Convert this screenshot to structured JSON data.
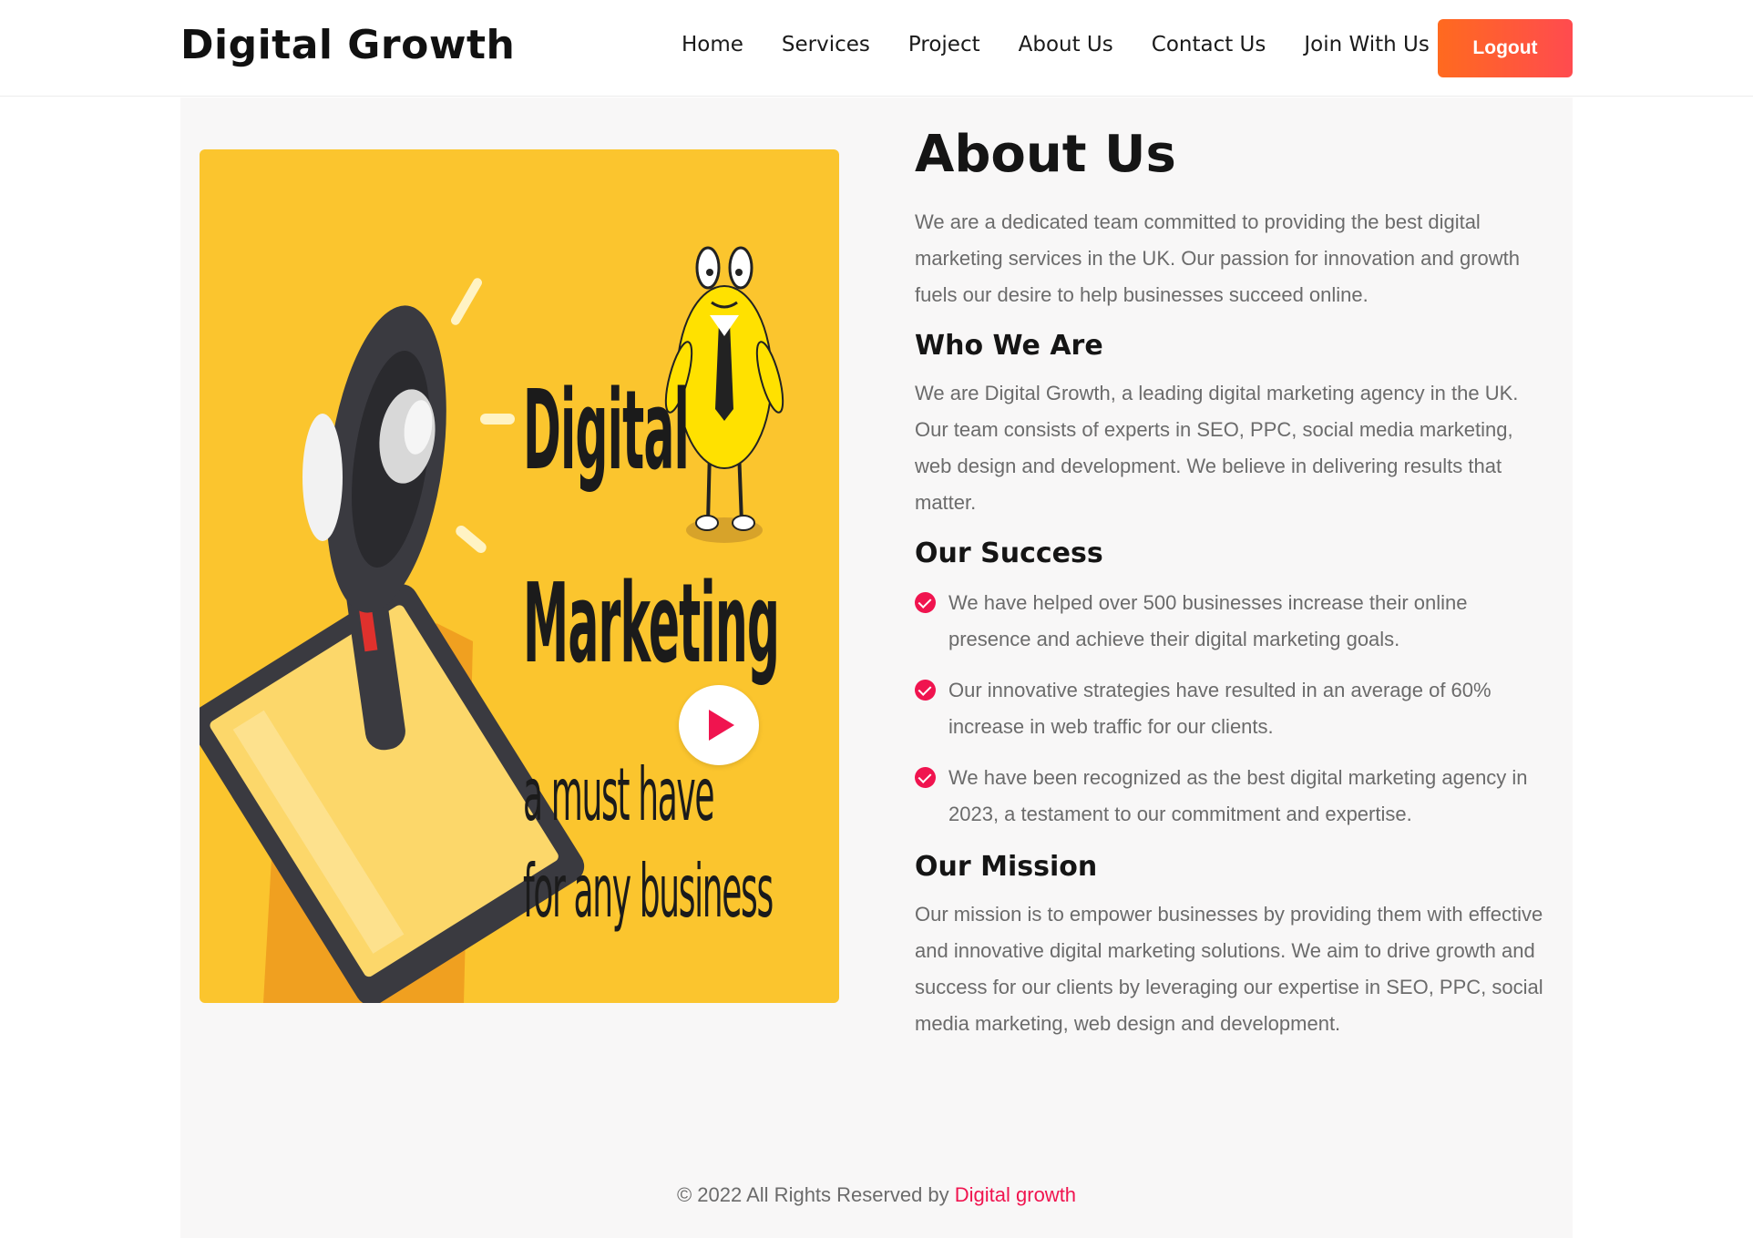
{
  "header": {
    "brand": "Digital Growth",
    "nav": [
      {
        "label": "Home"
      },
      {
        "label": "Services"
      },
      {
        "label": "Project"
      },
      {
        "label": "About Us"
      },
      {
        "label": "Contact Us"
      },
      {
        "label": "Join With Us"
      }
    ],
    "logout_label": "Logout"
  },
  "hero": {
    "line1": "Digital",
    "line2": "Marketing",
    "line3": "a must have",
    "line4": "for any business",
    "background_color": "#fbc52e",
    "play_icon": "play-icon"
  },
  "about": {
    "title": "About Us",
    "intro": "We are a dedicated team committed to providing the best digital marketing services in the UK. Our passion for innovation and growth fuels our desire to help businesses succeed online.",
    "who_title": "Who We Are",
    "who_text": "We are Digital Growth, a leading digital marketing agency in the UK. Our team consists of experts in SEO, PPC, social media marketing, web design and development. We believe in delivering results that matter.",
    "success_title": "Our Success",
    "success_items": [
      "We have helped over 500 businesses increase their online presence and achieve their digital marketing goals.",
      "Our innovative strategies have resulted in an average of 60% increase in web traffic for our clients.",
      "We have been recognized as the best digital marketing agency in 2023, a testament to our commitment and expertise."
    ],
    "mission_title": "Our Mission",
    "mission_text": "Our mission is to empower businesses by providing them with effective and innovative digital marketing solutions. We aim to drive growth and success for our clients by leveraging our expertise in SEO, PPC, social media marketing, web design and development."
  },
  "footer": {
    "text": "© 2022 All Rights Reserved by ",
    "link": "Digital growth"
  },
  "colors": {
    "accent": "#f0144f",
    "button_gradient_start": "#ff6a1f",
    "button_gradient_end": "#ff4b4f"
  }
}
